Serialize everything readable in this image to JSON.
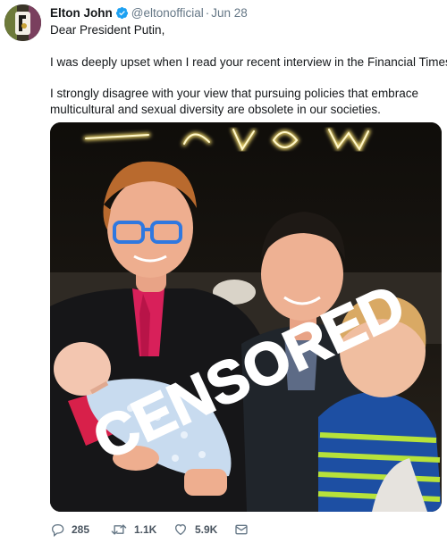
{
  "tweet": {
    "display_name": "Elton John",
    "handle": "@eltonofficial",
    "separator": "·",
    "timestamp": "Jun 28",
    "paragraphs": [
      "Dear President Putin,",
      "I was deeply upset when I read your recent interview in the Financial Times.",
      "I strongly disagree with your view that pursuing policies that embrace multicultural and sexual diversity are obsolete in our societies."
    ],
    "image": {
      "overlay_text": "CENSORED",
      "background_sign_text": "LONDON"
    },
    "actions": {
      "reply_count": "285",
      "retweet_count": "1.1K",
      "like_count": "5.9K",
      "reply_icon": "reply-icon",
      "retweet_icon": "retweet-icon",
      "like_icon": "heart-icon",
      "dm_icon": "envelope-icon"
    },
    "colors": {
      "verified": "#1da1f2",
      "secondary_text": "#657786",
      "primary_text": "#14171a"
    }
  }
}
